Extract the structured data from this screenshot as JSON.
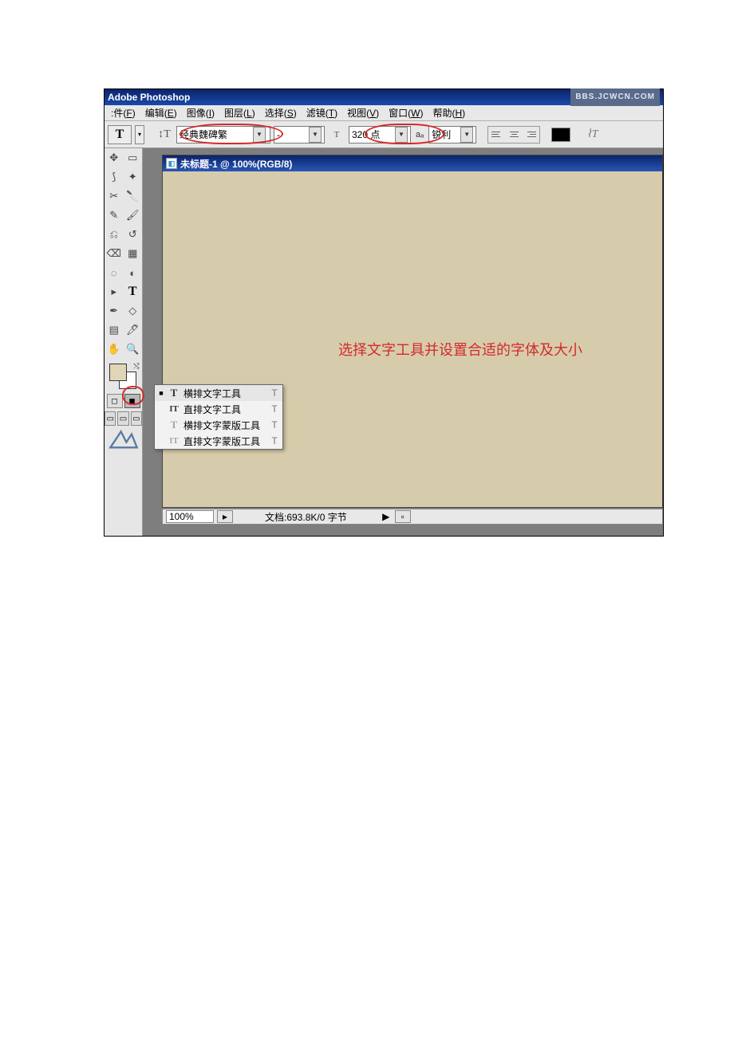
{
  "app": {
    "title": "Adobe Photoshop",
    "watermark": "BBS.JCWCN.COM"
  },
  "menu": {
    "items": [
      {
        "label": "件(F)",
        "u": "F"
      },
      {
        "label": "编辑(E)",
        "u": "E"
      },
      {
        "label": "图像(I)",
        "u": "I"
      },
      {
        "label": "图层(L)",
        "u": "L"
      },
      {
        "label": "选择(S)",
        "u": "S"
      },
      {
        "label": "滤镜(T)",
        "u": "T"
      },
      {
        "label": "视图(V)",
        "u": "V"
      },
      {
        "label": "窗口(W)",
        "u": "W"
      },
      {
        "label": "帮助(H)",
        "u": "H"
      }
    ]
  },
  "options": {
    "tool_letter": "T",
    "font_family": "经典魏碑繁",
    "font_style": "-",
    "font_size": "320 点",
    "aa_label": "aₐ",
    "aa_value": "锐利"
  },
  "document": {
    "title": "未标题-1 @ 100%(RGB/8)",
    "annotation": "选择文字工具并设置合适的字体及大小"
  },
  "status": {
    "zoom": "100%",
    "doc_info": "文档:693.8K/0 字节"
  },
  "flyout": {
    "items": [
      {
        "icon": "T",
        "dim": false,
        "label": "横排文字工具",
        "key": "T",
        "selected": true
      },
      {
        "icon": "IT",
        "dim": false,
        "label": "直排文字工具",
        "key": "T",
        "selected": false
      },
      {
        "icon": "T",
        "dim": true,
        "label": "横排文字蒙版工具",
        "key": "T",
        "selected": false
      },
      {
        "icon": "IT",
        "dim": true,
        "label": "直排文字蒙版工具",
        "key": "T",
        "selected": false
      }
    ]
  }
}
